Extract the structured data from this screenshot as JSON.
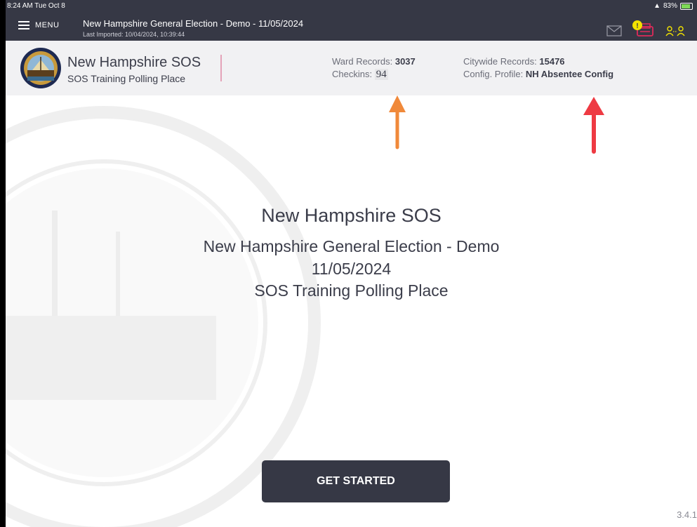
{
  "status": {
    "time": "8:24 AM  Tue Oct 8",
    "battery": "83%"
  },
  "nav": {
    "menu_label": "MENU",
    "title": "New Hampshire General Election - Demo - 11/05/2024",
    "last_imported": "Last Imported: 10/04/2024, 10:39:44"
  },
  "header": {
    "org_name": "New Hampshire SOS",
    "polling_place": "SOS Training Polling Place",
    "ward_records_label": "Ward Records:",
    "ward_records_value": "3037",
    "checkins_label": "Checkins:",
    "checkins_value": "94",
    "citywide_records_label": "Citywide Records:",
    "citywide_records_value": "15476",
    "config_profile_label": "Config. Profile:",
    "config_profile_value": "NH Absentee Config"
  },
  "main": {
    "org_name": "New Hampshire SOS",
    "election_name": "New Hampshire General Election - Demo",
    "election_date": "11/05/2024",
    "polling_place": "SOS Training Polling Place",
    "get_started_label": "GET STARTED"
  },
  "version": "3.4.1",
  "colors": {
    "nav_bg": "#363845",
    "header_bg": "#f1f1f3",
    "accent_yellow": "#f2e200",
    "arrow_orange": "#f0893a",
    "arrow_red": "#ee3a43"
  }
}
